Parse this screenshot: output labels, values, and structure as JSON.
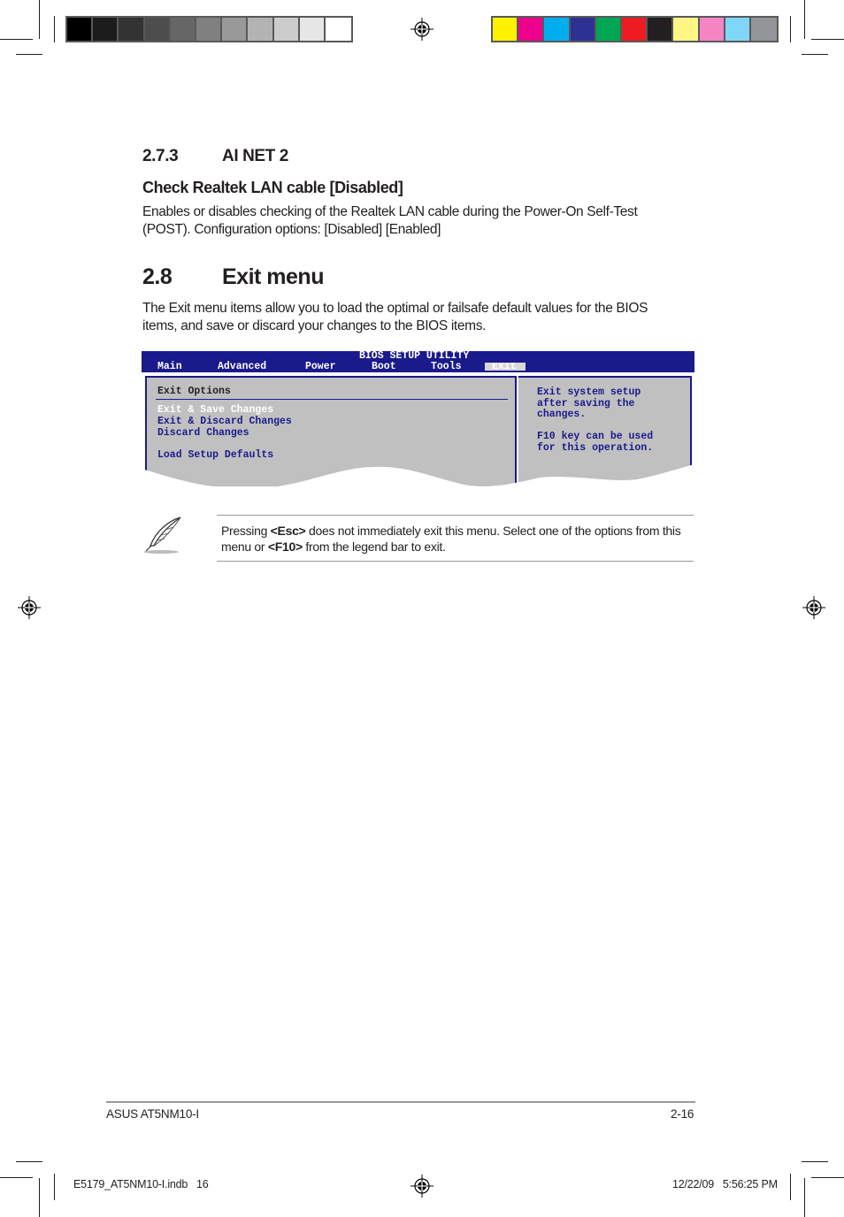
{
  "print_marks": {
    "gray_swatches": [
      "#000000",
      "#1c1c1c",
      "#333333",
      "#4d4d4d",
      "#666666",
      "#808080",
      "#999999",
      "#b3b3b3",
      "#cccccc",
      "#e6e6e6",
      "#ffffff"
    ],
    "color_swatches": [
      "#fff200",
      "#ec008c",
      "#00aeef",
      "#2e3192",
      "#00a651",
      "#ed1c24",
      "#231f20",
      "#fff685",
      "#f484c4",
      "#7fd6f7",
      "#939598"
    ]
  },
  "section_273": {
    "number": "2.7.3",
    "title": "AI NET 2"
  },
  "check_lan": {
    "heading": "Check Realtek LAN cable [Disabled]",
    "line1": "Enables or disables checking of the Realtek LAN cable during the Power-On Self-Test",
    "line2": "(POST). Configuration options: [Disabled] [Enabled]"
  },
  "section_28": {
    "number": "2.8",
    "title": "Exit menu",
    "line1": "The Exit menu items allow you to load the optimal or failsafe default values for the BIOS",
    "line2": "items, and save or discard your changes to the BIOS items."
  },
  "bios": {
    "title": "BIOS SETUP UTILITY",
    "tabs": [
      "Main",
      "Advanced",
      "Power",
      "Boot",
      "Tools",
      "Exit"
    ],
    "active_tab": "Exit",
    "panel_title": "Exit Options",
    "items": [
      "Exit & Save Changes",
      "Exit & Discard Changes",
      "Discard Changes",
      "Load Setup Defaults"
    ],
    "selected_item": "Exit & Save Changes",
    "help": [
      "Exit system setup",
      "after saving the",
      "changes.",
      "F10 key can be used",
      "for this operation."
    ],
    "colors": {
      "bar": "#1a1a8c",
      "panel": "#c0c0c0",
      "selected_text": "#ffffff"
    }
  },
  "note": {
    "pre1": "Pressing ",
    "key1": "<Esc>",
    "post1": " does not immediately exit this menu. Select one of the options from this",
    "pre2": "menu or ",
    "key2": "<F10>",
    "post2": " from the legend bar to exit."
  },
  "footer": {
    "left": "ASUS AT5NM10-I",
    "right": "2-16"
  },
  "slug": {
    "file": "E5179_AT5NM10-I.indb   16",
    "date": "12/22/09   5:56:25 PM"
  }
}
